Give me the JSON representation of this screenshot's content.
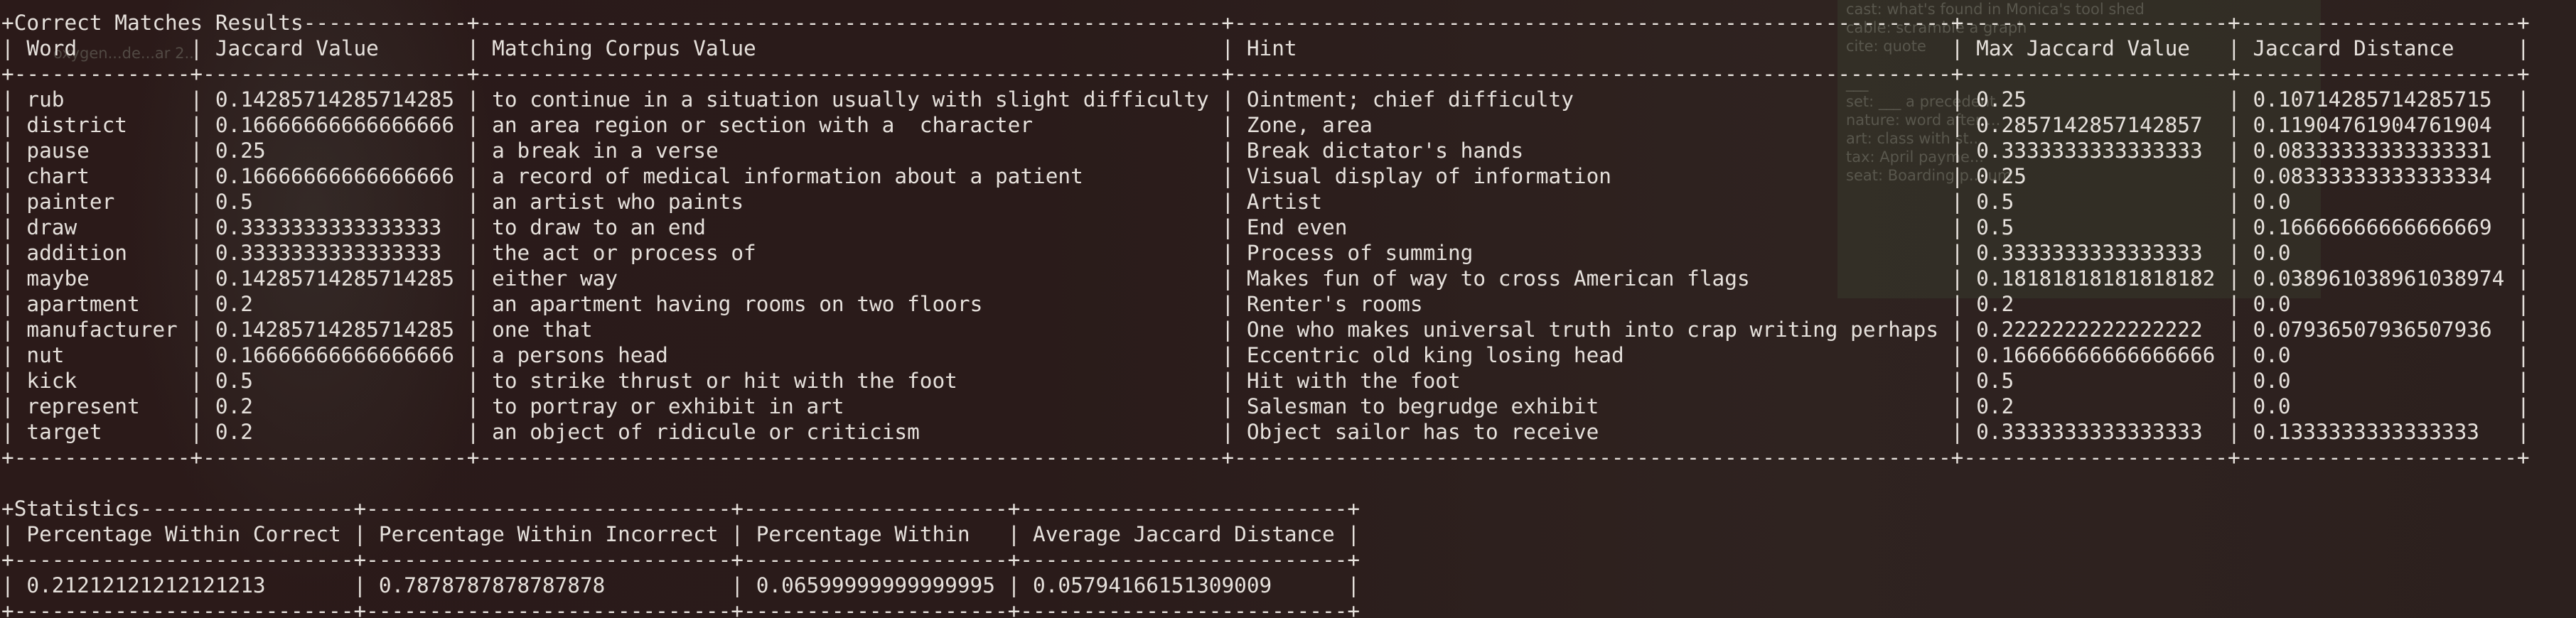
{
  "background": {
    "note_lines": [
      "cast: what's found in Monica's tool shed",
      "cable: scramble a graph",
      "cite: quote",
      "",
      "___",
      "set: ___ a precedent",
      "nature: word after ...",
      "art: class with st...",
      "tax: April payme...",
      "seat: Boarding p... um"
    ],
    "top_left_lines": [
      "oxygen",
      "...de",
      "...ar 2..."
    ]
  },
  "results_table": {
    "title": "Correct Matches Results",
    "columns": [
      "Word",
      "Jaccard Value",
      "Matching Corpus Value",
      "Hint",
      "Max Jaccard Value",
      "Jaccard Distance"
    ],
    "rows": [
      [
        "rub",
        "0.14285714285714285",
        "to continue in a situation usually with slight difficulty",
        "Ointment; chief difficulty",
        "0.25",
        "0.10714285714285715"
      ],
      [
        "district",
        "0.16666666666666666",
        "an area region or section with a  character",
        "Zone, area",
        "0.2857142857142857",
        "0.11904761904761904"
      ],
      [
        "pause",
        "0.25",
        "a break in a verse",
        "Break dictator's hands",
        "0.3333333333333333",
        "0.08333333333333331"
      ],
      [
        "chart",
        "0.16666666666666666",
        "a record of medical information about a patient",
        "Visual display of information",
        "0.25",
        "0.08333333333333334"
      ],
      [
        "painter",
        "0.5",
        "an artist who paints",
        "Artist",
        "0.5",
        "0.0"
      ],
      [
        "draw",
        "0.3333333333333333",
        "to draw to an end",
        "End even",
        "0.5",
        "0.16666666666666669"
      ],
      [
        "addition",
        "0.3333333333333333",
        "the act or process of",
        "Process of summing",
        "0.3333333333333333",
        "0.0"
      ],
      [
        "maybe",
        "0.14285714285714285",
        "either way",
        "Makes fun of way to cross American flags",
        "0.18181818181818182",
        "0.038961038961038974"
      ],
      [
        "apartment",
        "0.2",
        "an apartment having rooms on two floors",
        "Renter's rooms",
        "0.2",
        "0.0"
      ],
      [
        "manufacturer",
        "0.14285714285714285",
        "one that",
        "One who makes universal truth into crap writing perhaps",
        "0.2222222222222222",
        "0.07936507936507936"
      ],
      [
        "nut",
        "0.16666666666666666",
        "a persons head",
        "Eccentric old king losing head",
        "0.16666666666666666",
        "0.0"
      ],
      [
        "kick",
        "0.5",
        "to strike thrust or hit with the foot",
        "Hit with the foot",
        "0.5",
        "0.0"
      ],
      [
        "represent",
        "0.2",
        "to portray or exhibit in art",
        "Salesman to begrudge exhibit",
        "0.2",
        "0.0"
      ],
      [
        "target",
        "0.2",
        "an object of ridicule or criticism",
        "Object sailor has to receive",
        "0.3333333333333333",
        "0.1333333333333333"
      ]
    ]
  },
  "stats_table": {
    "title": "Statistics",
    "columns": [
      "Percentage Within Correct",
      "Percentage Within Incorrect",
      "Percentage Within",
      "Average Jaccard Distance"
    ],
    "rows": [
      [
        "0.21212121212121213",
        "0.7878787878787878",
        "0.06599999999999995",
        "0.05794166151309009"
      ]
    ]
  }
}
